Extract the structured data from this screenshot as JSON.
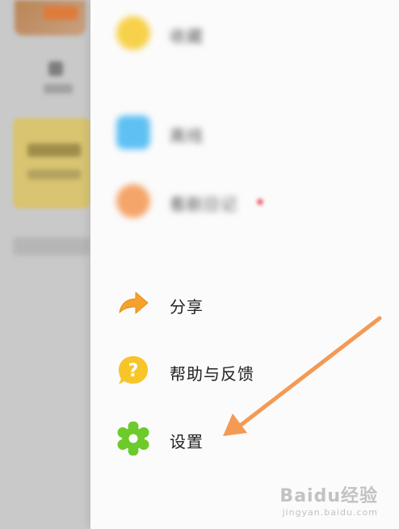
{
  "menu": {
    "items": [
      {
        "id": "blurred-1",
        "label": "收藏"
      },
      {
        "id": "blurred-2",
        "label": "离线"
      },
      {
        "id": "blurred-3",
        "label": "看剧日记"
      },
      {
        "id": "share",
        "label": "分享"
      },
      {
        "id": "help",
        "label": "帮助与反馈"
      },
      {
        "id": "settings",
        "label": "设置"
      }
    ]
  },
  "icons": {
    "share": "share-arrow-icon",
    "help": "question-mark-icon",
    "settings": "gear-icon"
  },
  "colors": {
    "share_icon": "#F6A12B",
    "help_icon": "#F7C52A",
    "settings_icon": "#6CCB2A",
    "annotation_arrow": "#F39A55"
  },
  "watermark": {
    "brand": "Baidu经验",
    "url": "jingyan.baidu.com"
  }
}
